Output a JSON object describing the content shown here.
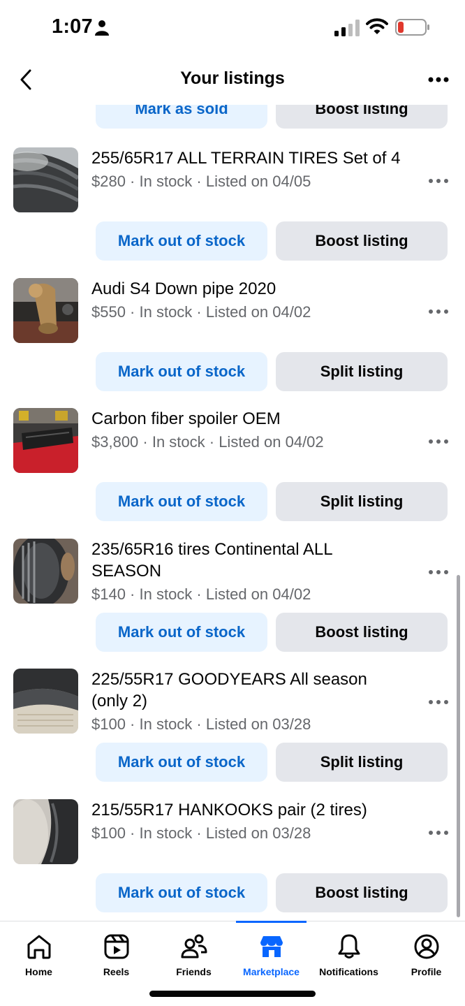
{
  "status_bar": {
    "time": "1:07",
    "icons": [
      "person-icon",
      "signal-icon",
      "wifi-icon",
      "battery-low-icon"
    ],
    "battery_color": "#e0382d"
  },
  "header": {
    "title": "Your listings",
    "back_icon": "chevron-left-icon",
    "more_icon": "more-horizontal-icon"
  },
  "partial_row": {
    "primary_label": "Mark as sold",
    "secondary_label": "Boost listing"
  },
  "listings": [
    {
      "title": "255/65R17 ALL TERRAIN TIRES Set of 4",
      "meta": "$280 · In stock · Listed on 04/05",
      "primary_label": "Mark out of stock",
      "secondary_label": "Boost listing",
      "thumbnail": "tire-photo"
    },
    {
      "title": "Audi S4 Down pipe 2020",
      "meta": "$550 · In stock · Listed on 04/02",
      "primary_label": "Mark out of stock",
      "secondary_label": "Split listing",
      "thumbnail": "downpipe-photo"
    },
    {
      "title": "Carbon fiber spoiler OEM",
      "meta": "$3,800 · In stock · Listed on 04/02",
      "primary_label": "Mark out of stock",
      "secondary_label": "Split listing",
      "thumbnail": "spoiler-photo"
    },
    {
      "title": "235/65R16 tires Continental ALL SEASON",
      "meta": "$140 · In stock · Listed on 04/02",
      "primary_label": "Mark out of stock",
      "secondary_label": "Boost listing",
      "thumbnail": "tire-photo"
    },
    {
      "title": "225/55R17 GOODYEARS All season (only 2)",
      "meta": "$100 · In stock · Listed on 03/28",
      "primary_label": "Mark out of stock",
      "secondary_label": "Split listing",
      "thumbnail": "tire-stack-photo"
    },
    {
      "title": "215/55R17 HANKOOKS pair (2 tires)",
      "meta": "$100 · In stock · Listed on 03/28",
      "primary_label": "Mark out of stock",
      "secondary_label": "Boost listing",
      "thumbnail": "tire-sidewall-photo"
    }
  ],
  "tab_bar": {
    "tabs": [
      {
        "label": "Home",
        "icon": "home-icon"
      },
      {
        "label": "Reels",
        "icon": "reels-icon"
      },
      {
        "label": "Friends",
        "icon": "friends-icon"
      },
      {
        "label": "Marketplace",
        "icon": "marketplace-icon"
      },
      {
        "label": "Notifications",
        "icon": "bell-icon"
      },
      {
        "label": "Profile",
        "icon": "profile-icon"
      }
    ],
    "active_tab": "Marketplace",
    "active_color": "#0866ff"
  },
  "colors": {
    "primary_button_bg": "#e7f3ff",
    "primary_button_text": "#0a66c9",
    "secondary_button_bg": "#e4e6eb",
    "meta_text": "#65676b"
  }
}
